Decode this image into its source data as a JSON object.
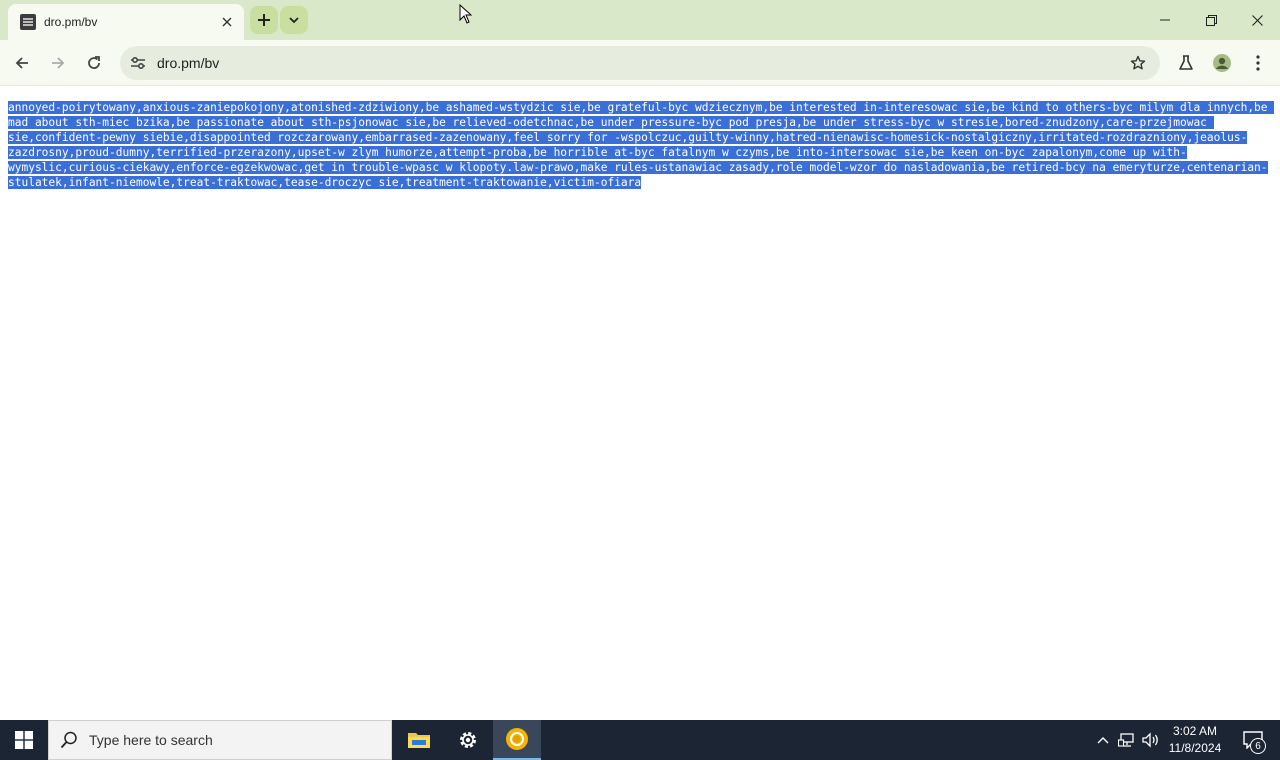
{
  "tab": {
    "title": "dro.pm/bv",
    "close_icon": "close-icon"
  },
  "window_controls": {
    "minimize": "minimize-icon",
    "maximize": "restore-icon",
    "close": "close-icon"
  },
  "toolbar": {
    "url": "dro.pm/bv",
    "icons": [
      "back-arrow-icon",
      "forward-arrow-icon",
      "reload-icon",
      "site-info-icon",
      "star-icon",
      "labs-flask-icon",
      "profile-icon",
      "more-vert-icon"
    ]
  },
  "page": {
    "text": "annoyed-poirytowany,anxious-zaniepokojony,atonished-zdziwiony,be ashamed-wstydzic sie,be grateful-byc wdziecznym,be interested in-interesowac sie,be kind to others-byc milym dla innych,be mad about sth-miec bzika,be passionate about sth-psjonowac sie,be relieved-odetchnac,be under pressure-byc pod presja,be under stress-byc w stresie,bored-znudzony,care-przejmowac sie,confident-pewny siebie,disappointed rozczarowany,embarrased-zazenowany,feel sorry for -wspolczuc,guilty-winny,hatred-nienawisc-homesick-nostalgiczny,irritated-rozdrazniony,jeaolus-zazdrosny,proud-dumny,terrified-przerazony,upset-w zlym humorze,attempt-proba,be horrible at-byc fatalnym w czyms,be into-intersowac sie,be keen on-byc zapalonym,come up with-wymyslic,curious-ciekawy,enforce-egzekwowac,get in trouble-wpasc w klopoty.law-prawo,make rules-ustanawiac zasady,role model-wzor do nasladowania,be retired-bcy na emeryturze,centenarian-stulatek,infant-niemowle,treat-traktowac,tease-droczyc sie,treatment-traktowanie,victim-ofiara",
    "selection_color": "#3b6fd8"
  },
  "taskbar": {
    "search_placeholder": "Type here to search",
    "apps": [
      "file-explorer-icon",
      "settings-icon",
      "chrome-icon"
    ],
    "clock_time": "3:02 AM",
    "clock_date": "11/8/2024",
    "notification_count": "6"
  },
  "colors": {
    "titlebar": "#d9e8c9",
    "toolbar": "#f6faf1",
    "omnibox": "#e7edde",
    "taskbar": "#1c2533"
  }
}
